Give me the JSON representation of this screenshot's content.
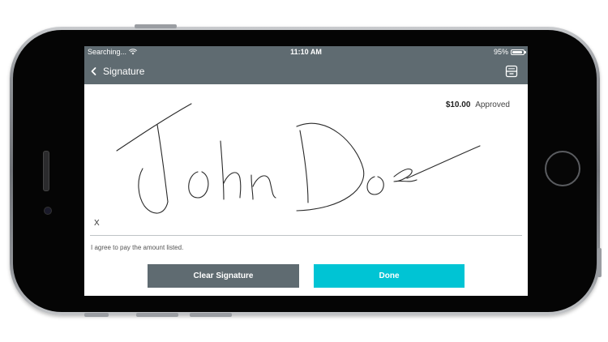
{
  "status_bar": {
    "carrier": "Searching...",
    "time": "11:10 AM",
    "battery_percent": "95%",
    "battery_level": 0.95
  },
  "nav": {
    "title": "Signature",
    "back_icon": "chevron-left-icon",
    "drawer_icon": "cash-drawer-icon"
  },
  "payment": {
    "amount": "$10.00",
    "status": "Approved"
  },
  "signature": {
    "x_mark": "X",
    "agreement": "I agree to pay the amount listed.",
    "signed_name_strokes": "John Doe"
  },
  "buttons": {
    "clear": "Clear Signature",
    "done": "Done"
  },
  "colors": {
    "bar": "#5f6b71",
    "accent": "#00c4d4",
    "clear_button": "#5f6b71"
  }
}
